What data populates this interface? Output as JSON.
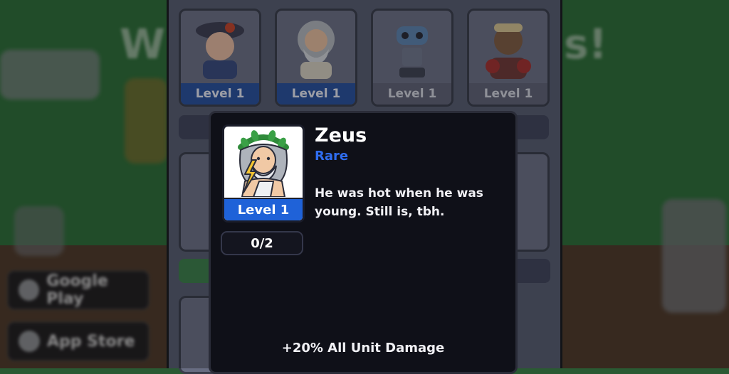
{
  "modal": {
    "hero_name": "Zeus",
    "rarity": "Rare",
    "description": "He was hot when he was young. Still is, tbh.",
    "level_label": "Level 1",
    "progress": "0/2",
    "bonus": "+20% All Unit Damage"
  },
  "roster": {
    "cards": [
      {
        "level_label": "Level 1",
        "state": "owned",
        "portrait": "napoleon-portrait"
      },
      {
        "level_label": "Level 1",
        "state": "owned",
        "portrait": "zeus-portrait"
      },
      {
        "level_label": "Level 1",
        "state": "locked",
        "portrait": "robot-portrait"
      },
      {
        "level_label": "Level 1",
        "state": "locked",
        "portrait": "boxer-portrait"
      }
    ]
  },
  "colors": {
    "rarity_rare": "#2f6df0",
    "level_owned": "#1f62d8",
    "modal_bg": "#0f1018"
  }
}
